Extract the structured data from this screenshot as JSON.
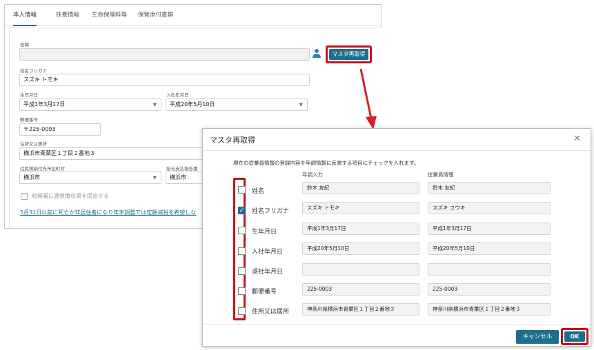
{
  "tabs": [
    "本人情報",
    "扶養情報",
    "生命保険料等",
    "保管添付書類"
  ],
  "form": {
    "post_label": "役職",
    "post_value": "",
    "person_icon": "person-icon",
    "master_button": "マスタ再取得",
    "kana_label": "姓名フリガナ",
    "kana_value": "スズキ トモキ",
    "birth_label": "生年月日",
    "birth_value": "平成1年3月17日",
    "join_label": "入社年月日",
    "join_value": "平成20年5月10日",
    "postal_label": "郵便番号",
    "postal_value": "〒225-0003",
    "address_label": "住所又は居所",
    "address_value": "横浜市青葉区１丁目２番地３",
    "tax_city_label": "住民税納付先市区町村",
    "tax_city_value": "横浜市",
    "pay_report_label": "給与支払報告書",
    "pay_report_value": "横浜市",
    "submit_label": "税務署に源泉徴収票を提出する",
    "link_text": "5月31日以前に死亡か非居住者になり年末調整では定額減税を希望しな"
  },
  "dialog": {
    "title": "マスタ再取得",
    "close_icon": "close-icon",
    "instruction": "現在の従業員情報の登録内容を年調情報に反映する項目にチェックを入れます。",
    "col_year_end": "年調入力",
    "col_employee": "従業員情報",
    "rows": [
      {
        "label": "姓名",
        "checked": false,
        "year_end": "鈴木 友紀",
        "employee": "鈴木 友紀"
      },
      {
        "label": "姓名フリガナ",
        "checked": true,
        "year_end": "スズキ トモキ",
        "employee": "スズキ ユウキ"
      },
      {
        "label": "生年月日",
        "checked": false,
        "year_end": "平成1年3月17日",
        "employee": "平成1年3月17日"
      },
      {
        "label": "入社年月日",
        "checked": false,
        "year_end": "平成20年5月10日",
        "employee": "平成20年5月10日"
      },
      {
        "label": "退社年月日",
        "checked": false,
        "year_end": "",
        "employee": ""
      },
      {
        "label": "郵便番号",
        "checked": false,
        "year_end": "225-0003",
        "employee": "225-0003"
      },
      {
        "label": "住所又は居所",
        "checked": false,
        "year_end": "神奈川県横浜市青葉区１丁目２番地３",
        "employee": "神奈川県横浜市青葉区１丁目２番地３"
      }
    ],
    "cancel_label": "キャンセル",
    "ok_label": "OK"
  },
  "colors": {
    "accent": "#1e6f8e",
    "highlight": "#c1121c"
  }
}
